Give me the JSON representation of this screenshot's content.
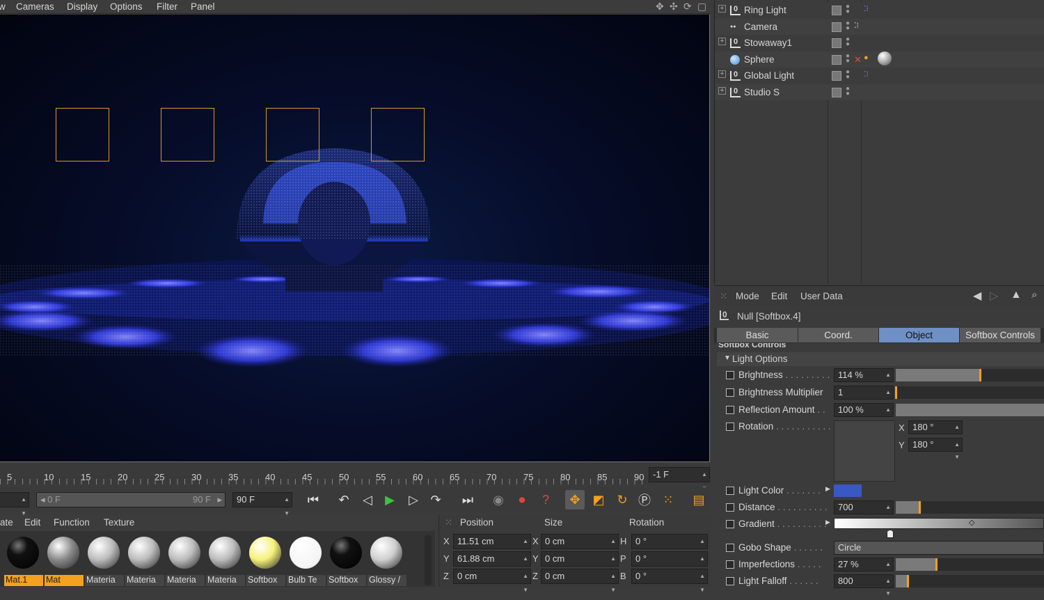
{
  "menubar": {
    "items": [
      "w",
      "Cameras",
      "Display",
      "Options",
      "Filter",
      "Panel"
    ]
  },
  "timeline": {
    "ticks": [
      "5",
      "10",
      "15",
      "20",
      "25",
      "30",
      "35",
      "40",
      "45",
      "50",
      "55",
      "60",
      "65",
      "70",
      "75",
      "80",
      "85",
      "90"
    ],
    "current_frame": "-1 F",
    "range_start": "0 F",
    "range_end": "90 F",
    "end_field": "90 F"
  },
  "materials": {
    "menu": [
      "ate",
      "Edit",
      "Function",
      "Texture"
    ],
    "items": [
      {
        "label": "Mat.1",
        "color": "#0d0d0d",
        "selected": true
      },
      {
        "label": "Mat",
        "color": "#8a8a8a",
        "selected": true
      },
      {
        "label": "Materia",
        "color": "#bcbcbc",
        "selected": false
      },
      {
        "label": "Materia",
        "color": "#bcbcbc",
        "selected": false
      },
      {
        "label": "Materia",
        "color": "#bcbcbc",
        "selected": false
      },
      {
        "label": "Materia",
        "color": "#bcbcbc",
        "selected": false
      },
      {
        "label": "Softbox",
        "color": "#f6f17a",
        "selected": false
      },
      {
        "label": "Bulb Te",
        "color": "#ffffff",
        "selected": false
      },
      {
        "label": "Softbox",
        "color": "#050505",
        "selected": false
      },
      {
        "label": "Glossy /",
        "color": "#cfcfcf",
        "selected": false
      }
    ]
  },
  "coords": {
    "headers": {
      "position": "Position",
      "size": "Size",
      "rotation": "Rotation"
    },
    "rows": [
      {
        "axis": "X",
        "pos": "11.51 cm",
        "saxis": "X",
        "size": "0 cm",
        "raxis": "H",
        "rot": "0 °"
      },
      {
        "axis": "Y",
        "pos": "61.88 cm",
        "saxis": "Y",
        "size": "0 cm",
        "raxis": "P",
        "rot": "0 °"
      },
      {
        "axis": "Z",
        "pos": "0 cm",
        "saxis": "Z",
        "size": "0 cm",
        "raxis": "B",
        "rot": "0 °"
      }
    ]
  },
  "objects": [
    {
      "name": "Ring Light",
      "icon": "null-icon",
      "expandable": true
    },
    {
      "name": "Camera",
      "icon": "camera-icon",
      "expandable": false
    },
    {
      "name": "Stowaway1",
      "icon": "null-icon",
      "expandable": true
    },
    {
      "name": "Sphere",
      "icon": "sphere-icon",
      "expandable": false
    },
    {
      "name": "Global Light",
      "icon": "null-icon",
      "expandable": true
    },
    {
      "name": "Studio S",
      "icon": "null-icon",
      "expandable": true
    }
  ],
  "attributes": {
    "menu": [
      "Mode",
      "Edit",
      "User Data"
    ],
    "title": "Null [Softbox.4]",
    "tabs": [
      "Basic",
      "Coord.",
      "Object",
      "Softbox Controls"
    ],
    "active_tab": "Object",
    "cut_heading": "Softbox Controls",
    "group": "Light Options",
    "brightness": {
      "label": "Brightness",
      "dots": " . . . . . . . . .",
      "value": "114 %",
      "level": 0.57
    },
    "brightness_multiplier": {
      "label": "Brightness Multiplier",
      "value": "1",
      "level": 0.0
    },
    "reflection": {
      "label": "Reflection Amount",
      "dots": " . .",
      "value": "100 %",
      "level": 1.0
    },
    "rotation": {
      "label": "Rotation",
      "dots": " . . . . . . . . . . .",
      "x_label": "X",
      "x": "180 °",
      "y_label": "Y",
      "y": "180 °"
    },
    "light_color": {
      "label": "Light Color",
      "dots": " . . . . . . .",
      "color": "#3a58c2"
    },
    "distance": {
      "label": "Distance",
      "dots": " . . . . . . . . . .",
      "value": "700",
      "level": 0.16
    },
    "gradient": {
      "label": "Gradient",
      "dots": " . . . . . . . . . ."
    },
    "gobo": {
      "label": "Gobo Shape",
      "dots": " . . . . . .",
      "value": "Circle"
    },
    "imperfections": {
      "label": "Imperfections",
      "dots": " . . . . .",
      "value": "27 %",
      "level": 0.27
    },
    "falloff": {
      "label": "Light Falloff",
      "dots": " . . . . . .",
      "value": "800",
      "level": 0.08
    }
  },
  "colors": {
    "accent": "#f3a11f",
    "tab_active": "#6f90c4",
    "glow": "#3a5cff"
  }
}
